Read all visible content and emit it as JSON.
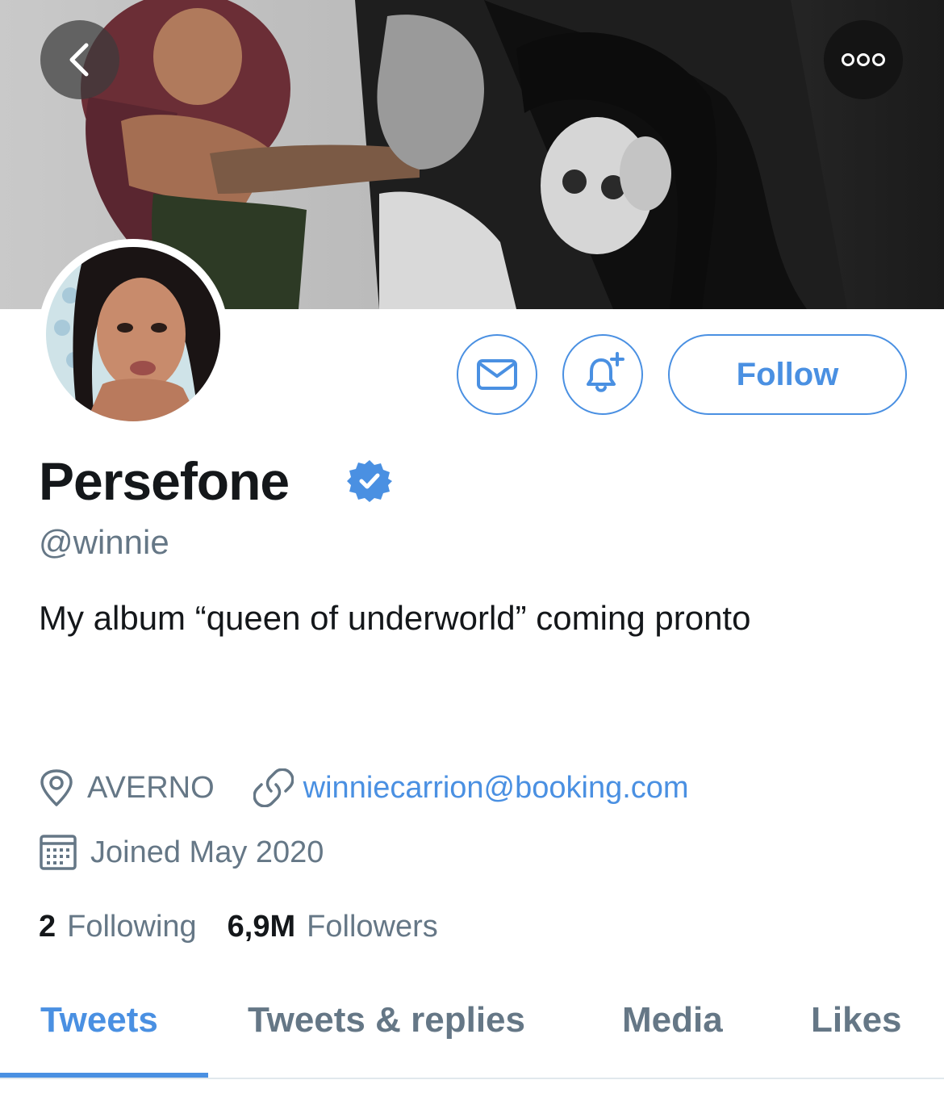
{
  "header": {
    "banner_image": "illustrated-underworld-couple-artwork",
    "back_icon": "chevron-left-icon",
    "more_icon": "more-dots-icon"
  },
  "profile": {
    "avatar_image": "profile-photo",
    "display_name": "Persefone",
    "verified_icon": "verified-badge-icon",
    "handle": "@winnie",
    "bio": "My album “queen of underworld” coming pronto",
    "location": "AVERNO",
    "website": "winniecarrion@booking.com",
    "joined": "Joined May 2020"
  },
  "actions": {
    "message_icon": "mail-icon",
    "notify_icon": "bell-plus-icon",
    "follow_label": "Follow"
  },
  "stats": {
    "following_count": "2",
    "following_label": "Following",
    "followers_count": "6,9M",
    "followers_label": "Followers"
  },
  "tabs": [
    {
      "label": "Tweets",
      "active": true
    },
    {
      "label": "Tweets & replies",
      "active": false
    },
    {
      "label": "Media",
      "active": false
    },
    {
      "label": "Likes",
      "active": false
    }
  ],
  "colors": {
    "accent": "#4a90e2",
    "secondary_text": "#657786",
    "primary_text": "#14171a",
    "verified": "#1da1f2"
  }
}
